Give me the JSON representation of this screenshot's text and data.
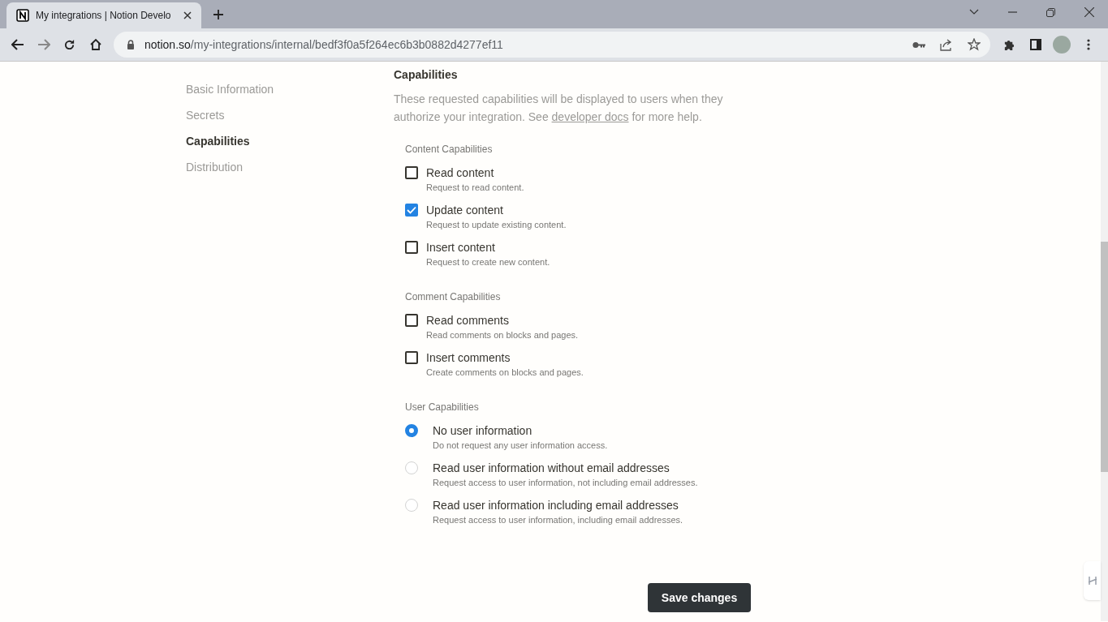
{
  "browser": {
    "tab_title": "My integrations | Notion Develo",
    "address": {
      "domain": "notion.so",
      "path": "/my-integrations/internal/bedf3f0a5f264ec6b3b0882d4277ef11"
    }
  },
  "sidebar": {
    "items": [
      {
        "label": "Basic Information",
        "selected": false
      },
      {
        "label": "Secrets",
        "selected": false
      },
      {
        "label": "Capabilities",
        "selected": true
      },
      {
        "label": "Distribution",
        "selected": false
      }
    ]
  },
  "capabilities": {
    "title": "Capabilities",
    "description": {
      "before": "These requested capabilities will be displayed to users when they authorize your integration. See ",
      "link": "developer docs",
      "after": " for more help."
    },
    "groups": [
      {
        "title": "Content Capabilities",
        "kind": "checkbox",
        "options": [
          {
            "label": "Read content",
            "description": "Request to read content.",
            "checked": false
          },
          {
            "label": "Update content",
            "description": "Request to update existing content.",
            "checked": true
          },
          {
            "label": "Insert content",
            "description": "Request to create new content.",
            "checked": false
          }
        ]
      },
      {
        "title": "Comment Capabilities",
        "kind": "checkbox",
        "options": [
          {
            "label": "Read comments",
            "description": "Read comments on blocks and pages.",
            "checked": false
          },
          {
            "label": "Insert comments",
            "description": "Create comments on blocks and pages.",
            "checked": false
          }
        ]
      },
      {
        "title": "User Capabilities",
        "kind": "radio",
        "options": [
          {
            "label": "No user information",
            "description": "Do not request any user information access.",
            "selected": true
          },
          {
            "label": "Read user information without email addresses",
            "description": "Request access to user information, not including email addresses.",
            "selected": false
          },
          {
            "label": "Read user information including email addresses",
            "description": "Request access to user information, including email addresses.",
            "selected": false
          }
        ]
      }
    ]
  },
  "save_button": "Save changes"
}
